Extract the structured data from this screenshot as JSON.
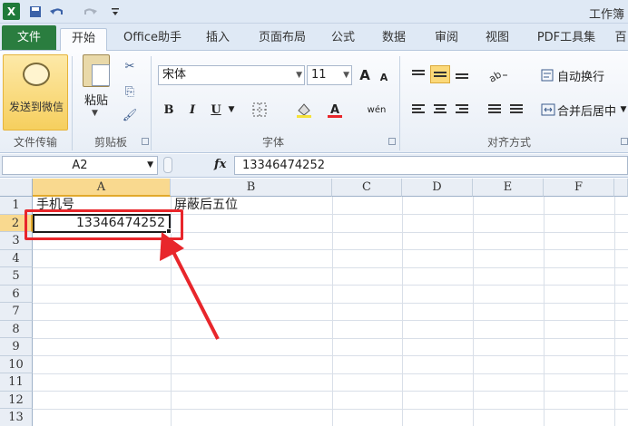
{
  "window": {
    "title": "工作簿"
  },
  "quick_access": {
    "app_icon": "X"
  },
  "tabs": [
    {
      "label": "文件"
    },
    {
      "label": "开始"
    },
    {
      "label": "Office助手"
    },
    {
      "label": "插入"
    },
    {
      "label": "页面布局"
    },
    {
      "label": "公式"
    },
    {
      "label": "数据"
    },
    {
      "label": "审阅"
    },
    {
      "label": "视图"
    },
    {
      "label": "PDF工具集"
    },
    {
      "label": "百"
    }
  ],
  "ribbon": {
    "wechat_label": "发送到微信",
    "file_transfer_group": "文件传输",
    "paste_label": "粘贴",
    "clipboard_group": "剪贴板",
    "font_name": "宋体",
    "font_size": "11",
    "font_group": "字体",
    "bold": "B",
    "italic": "I",
    "underline": "U",
    "wrap_text": "自动换行",
    "merge_center": "合并后居中",
    "alignment_group": "对齐方式",
    "phonetic": "wén",
    "grow_font": "A",
    "shrink_font": "A"
  },
  "formula_bar": {
    "name_box": "A2",
    "fx": "fx",
    "content": "13346474252"
  },
  "sheet": {
    "columns": [
      "A",
      "B",
      "C",
      "D",
      "E",
      "F"
    ],
    "rows": [
      "1",
      "2",
      "3",
      "4",
      "5",
      "6",
      "7",
      "8",
      "9",
      "10",
      "11",
      "12",
      "13"
    ],
    "cells": {
      "A1": "手机号",
      "B1": "屏蔽后五位",
      "A2": "13346474252"
    },
    "selected_cell": "A2"
  },
  "colors": {
    "file_tab": "#2a7d3f",
    "highlight": "#e8262b",
    "selection_header": "#f9d98f"
  }
}
